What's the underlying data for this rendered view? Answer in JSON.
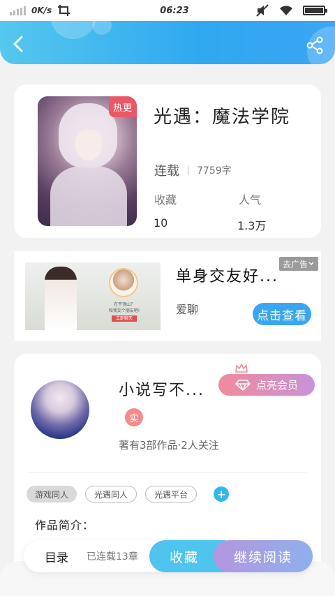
{
  "status_bar": {
    "speed": "0K/s",
    "time": "06:23"
  },
  "header": {
    "back_icon": "chevron-left-icon",
    "share_icon": "share-icon"
  },
  "book": {
    "badge": "热更",
    "title": "光遇：魔法学院",
    "status": "连载",
    "word_count": "7759字",
    "collect_label": "收藏",
    "collect_value": "10",
    "popularity_label": "人气",
    "popularity_value": "1.3万"
  },
  "ad": {
    "title": "单身交友好...",
    "subtitle": "爱聊",
    "close_label": "去广告",
    "button_label": "点击查看",
    "mini_text_1": "在平顶山？",
    "mini_text_2": "和我交个朋友吧!",
    "mini_button": "立即聊天"
  },
  "author": {
    "name": "小说写不...",
    "vip_label": "点亮会员",
    "real_badge": "实",
    "stats": "著有3部作品·2人关注",
    "tags": [
      "游戏同人",
      "光遇同人",
      "光遇平台"
    ],
    "tag_add": "+",
    "intro_label": "作品简介："
  },
  "bottom_bar": {
    "toc_label": "目录",
    "updates": "已连载13章",
    "collect_button": "收藏",
    "read_button": "继续阅读"
  },
  "colors": {
    "header_start": "#55c8ee",
    "header_end": "#3aa5f3",
    "accent_blue": "#4ec4ee",
    "vip_pink": "#f28a9c",
    "vip_purple": "#c793d8"
  }
}
